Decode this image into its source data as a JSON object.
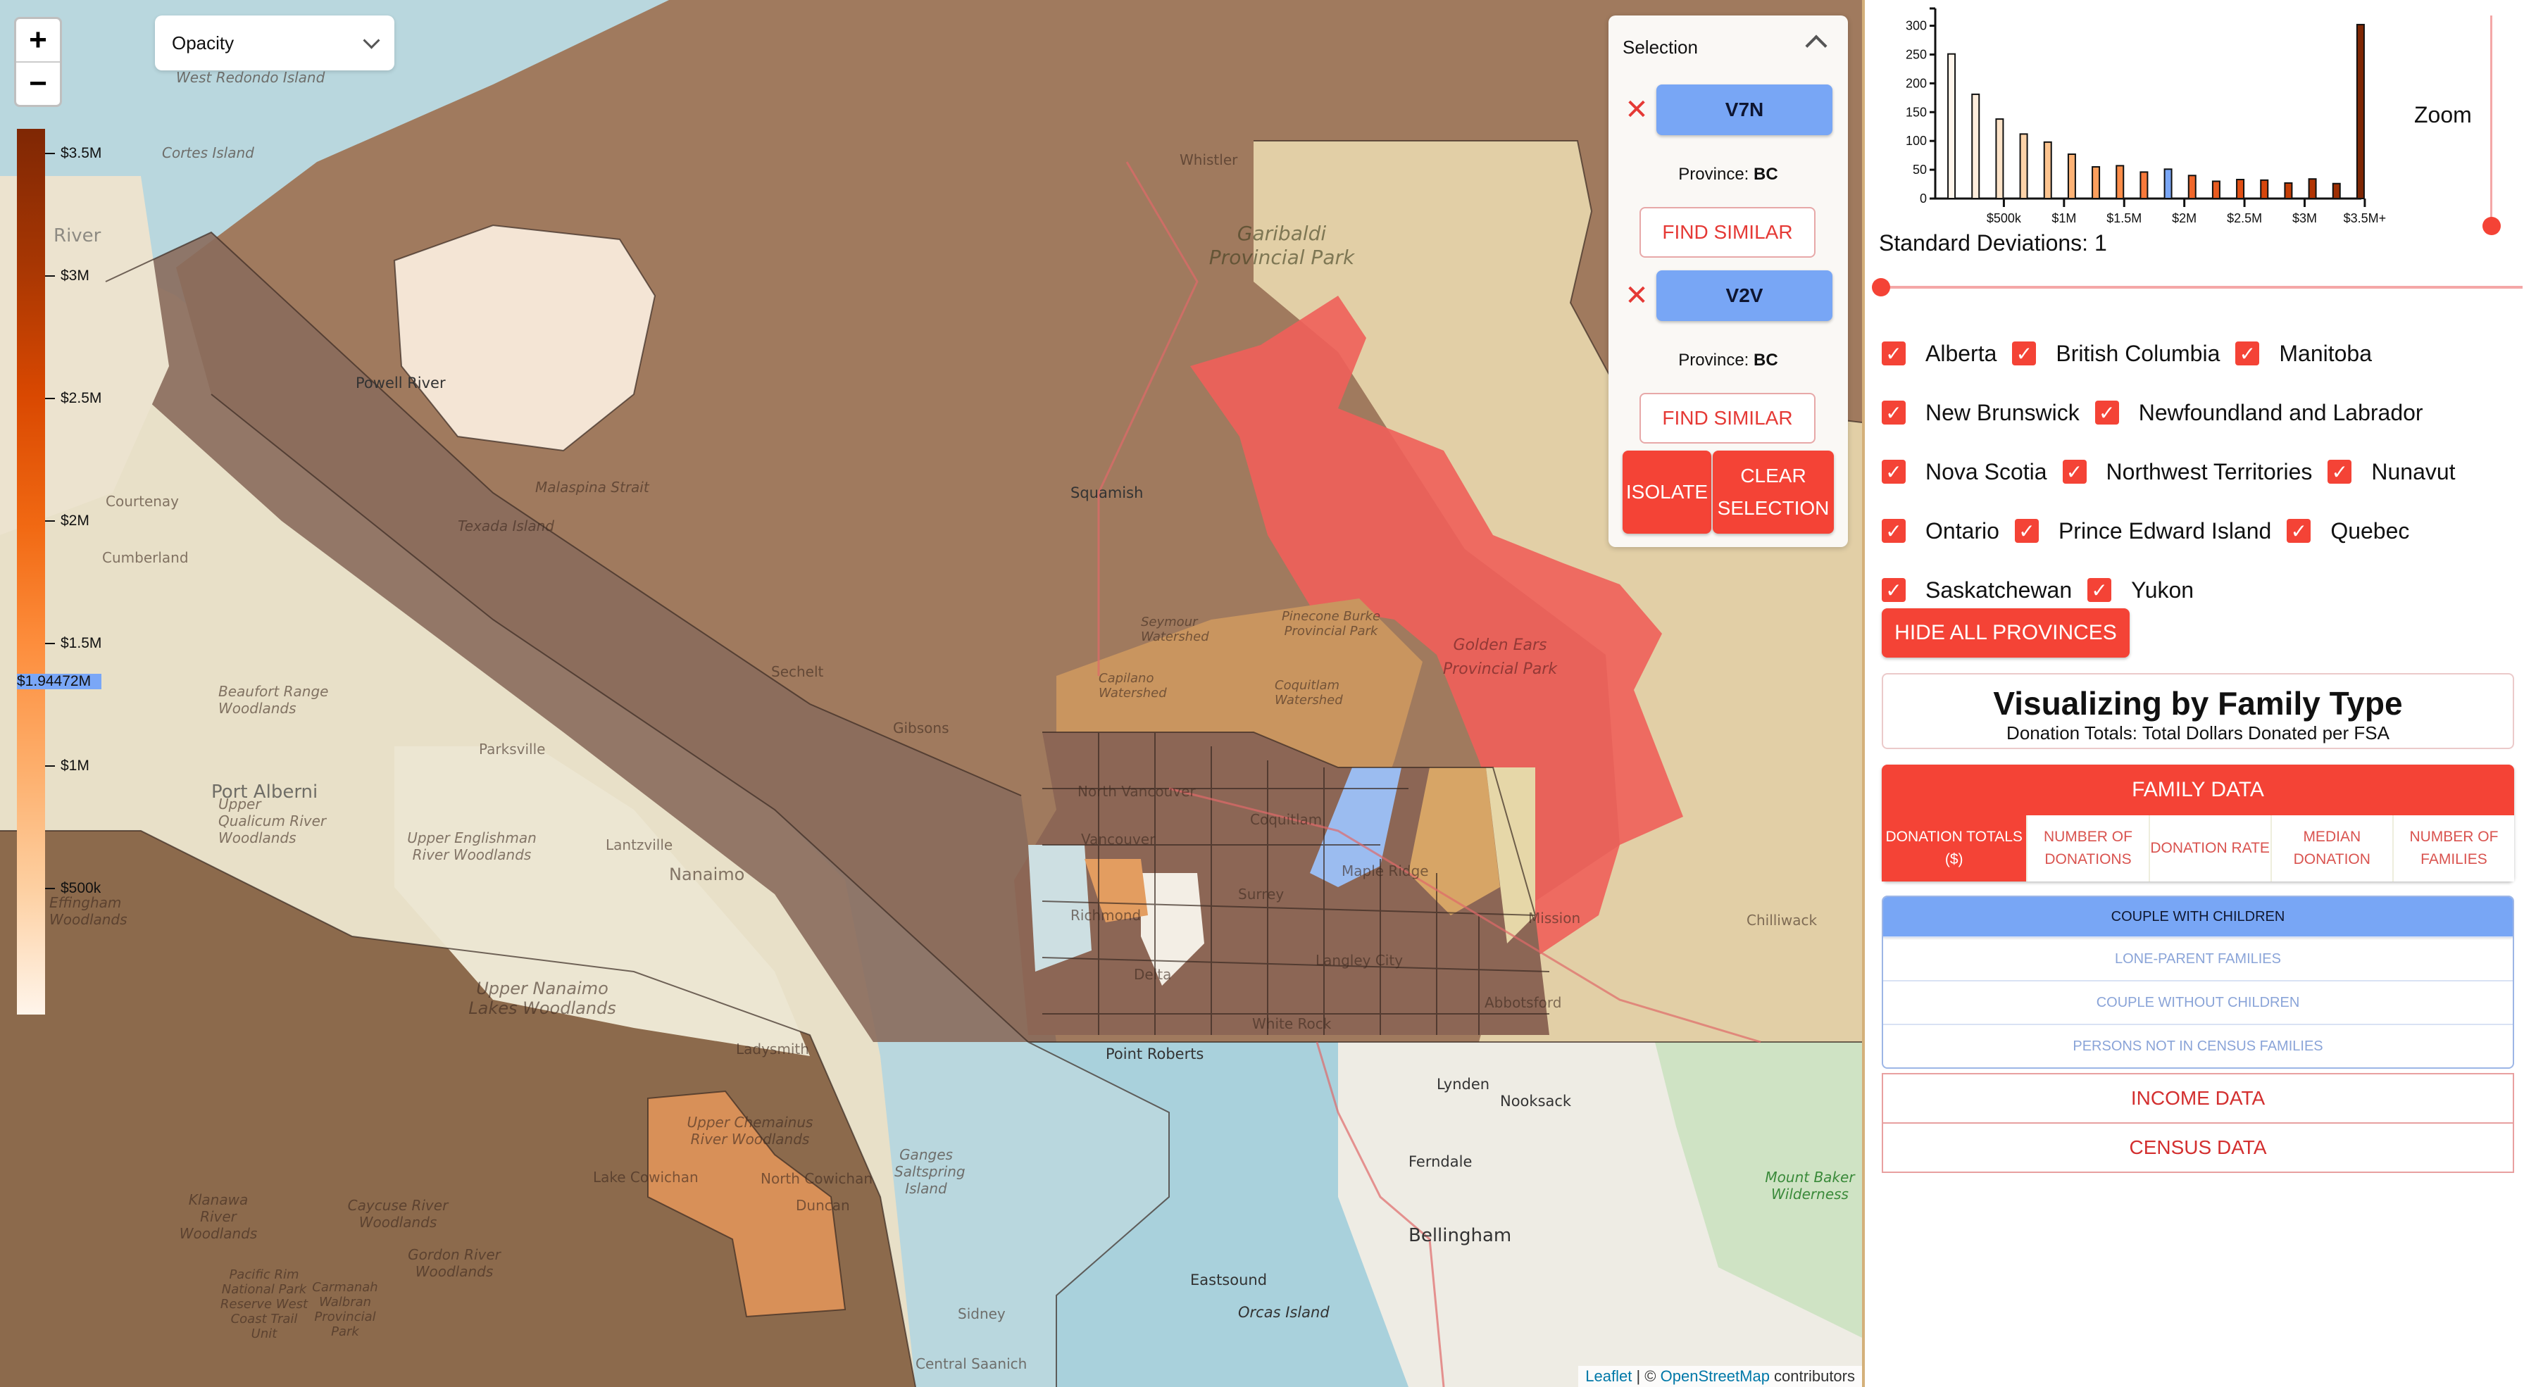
{
  "map": {
    "zoom_in_label": "+",
    "zoom_out_label": "−",
    "opacity_select": {
      "value": "Opacity"
    },
    "legend": {
      "ticks": [
        "$3.5M",
        "$3M",
        "$2.5M",
        "$2M",
        "$1.5M",
        "$1M",
        "$500k"
      ],
      "marker_value": "$1.94472M",
      "colors": [
        "#7f2704",
        "#d94801",
        "#fd8d3c",
        "#fdd0a2",
        "#fff5eb"
      ]
    },
    "labels": {
      "west_redondo": "West Redondo Island",
      "cortes": "Cortes Island",
      "powell_river": "Powell River",
      "river": "River",
      "courtenay": "Courtenay",
      "cumberland": "Cumberland",
      "texada": "Texada Island",
      "malaspina": "Malaspina Strait",
      "whistler": "Whistler",
      "garibaldi": "Garibaldi Provincial Park",
      "squamish": "Squamish",
      "sechelt": "Sechelt",
      "gibsons": "Gibsons",
      "seymour": "Seymour Watershed",
      "capilano": "Capilano Watershed",
      "coquitlam_ws": "Coquitlam Watershed",
      "pinecone": "Pinecone Burke Provincial Park",
      "golden_ears": "Golden Ears Provincial Park",
      "north_vancouver": "North Vancouver",
      "vancouver": "Vancouver",
      "coquitlam": "Coquitlam",
      "maple_ridge": "Maple Ridge",
      "surrey": "Surrey",
      "richmond": "Richmond",
      "mission": "Mission",
      "chilliwack": "Chilliwack",
      "langley": "Langley City",
      "delta": "Delta",
      "abbotsford": "Abbotsford",
      "white_rock": "White Rock",
      "point_roberts": "Point Roberts",
      "lynden": "Lynden",
      "nooksack": "Nooksack",
      "ferndale": "Ferndale",
      "bellingham": "Bellingham",
      "eastsound": "Eastsound",
      "orcas": "Orcas Island",
      "mount_baker": "Mount Baker Wilderness",
      "parksville": "Parksville",
      "port_alberni": "Port Alberni",
      "lantzville": "Lantzville",
      "nanaimo": "Nanaimo",
      "upper_englishman": "Upper Englishman River Woodlands",
      "upper_nanaimo": "Upper Nanaimo Lakes Woodlands",
      "ladysmith": "Ladysmith",
      "upper_chemainus": "Upper Chemainus River Woodlands",
      "lake_cowichan": "Lake Cowichan",
      "north_cowichan": "North Cowichan",
      "duncan": "Duncan",
      "saltspring": "Ganges Saltspring Island",
      "klanawa": "Klanawa River Woodlands",
      "caycuse": "Caycuse River Woodlands",
      "gordon": "Gordon River Woodlands",
      "pacific_rim": "Pacific Rim National Park Reserve West Coast Trail Unit",
      "carmanah": "Carmanah Walbran Provincial Park",
      "sidney": "Sidney",
      "central_saanich": "Central Saanich",
      "beaufort": "Beaufort Range Woodlands",
      "effingham": "Effingham Woodlands",
      "upper_qualicum": "Upper Qualicum River Woodlands"
    },
    "attribution": {
      "leaflet": "Leaflet",
      "sep": " | © ",
      "osm": "OpenStreetMap",
      "rest": " contributors"
    }
  },
  "selection": {
    "title": "Selection",
    "items": [
      {
        "fsa": "V7N",
        "province_label": "Province: ",
        "province": "BC",
        "find_similar": "FIND SIMILAR"
      },
      {
        "fsa": "V2V",
        "province_label": "Province: ",
        "province": "BC",
        "find_similar": "FIND SIMILAR"
      }
    ],
    "isolate": "ISOLATE",
    "clear": "CLEAR SELECTION"
  },
  "sidebar": {
    "zoom_label": "Zoom",
    "zoom_level": 0,
    "std_dev_label": "Standard Deviations: 1",
    "std_dev_value": 1,
    "provinces": [
      {
        "name": "Alberta",
        "checked": true
      },
      {
        "name": "British Columbia",
        "checked": true
      },
      {
        "name": "Manitoba",
        "checked": true
      },
      {
        "name": "New Brunswick",
        "checked": true
      },
      {
        "name": "Newfoundland and Labrador",
        "checked": true
      },
      {
        "name": "Nova Scotia",
        "checked": true
      },
      {
        "name": "Northwest Territories",
        "checked": true
      },
      {
        "name": "Nunavut",
        "checked": true
      },
      {
        "name": "Ontario",
        "checked": true
      },
      {
        "name": "Prince Edward Island",
        "checked": true
      },
      {
        "name": "Quebec",
        "checked": true
      },
      {
        "name": "Saskatchewan",
        "checked": true
      },
      {
        "name": "Yukon",
        "checked": true
      }
    ],
    "hide_all": "HIDE ALL PROVINCES",
    "title": "Visualizing by Family Type",
    "subtitle": "Donation Totals: Total Dollars Donated per FSA",
    "family_data": "FAMILY DATA",
    "family_tabs": [
      "DONATION TOTALS ($)",
      "NUMBER OF DONATIONS",
      "DONATION RATE",
      "MEDIAN DONATION",
      "NUMBER OF FAMILIES"
    ],
    "family_types": [
      "COUPLE WITH CHILDREN",
      "LONE-PARENT FAMILIES",
      "COUPLE WITHOUT CHILDREN",
      "PERSONS NOT IN CENSUS FAMILIES"
    ],
    "income_data": "INCOME DATA",
    "census_data": "CENSUS DATA"
  },
  "chart_data": {
    "type": "bar",
    "title": "",
    "xlabel": "",
    "ylabel": "",
    "ylim": [
      0,
      330
    ],
    "yticks": [
      0,
      50,
      100,
      150,
      200,
      250,
      300
    ],
    "xtick_labels": [
      "$500k",
      "$1M",
      "$1.5M",
      "$2M",
      "$2.5M",
      "$3M",
      "$3.5M+"
    ],
    "xtick_values": [
      500000,
      1000000,
      1500000,
      2000000,
      2500000,
      3000000,
      3500000
    ],
    "bin_width": 200000,
    "bin_starts": [
      0,
      200000,
      400000,
      600000,
      800000,
      1000000,
      1200000,
      1400000,
      1600000,
      1800000,
      2000000,
      2200000,
      2400000,
      2600000,
      2800000,
      3000000,
      3200000,
      3400000
    ],
    "values": [
      251,
      181,
      138,
      112,
      98,
      77,
      55,
      57,
      46,
      51,
      40,
      30,
      33,
      32,
      27,
      34,
      26,
      302
    ],
    "highlight_index": 9,
    "highlight_color": "#7aa7f7",
    "grid": false,
    "legend": "none"
  }
}
